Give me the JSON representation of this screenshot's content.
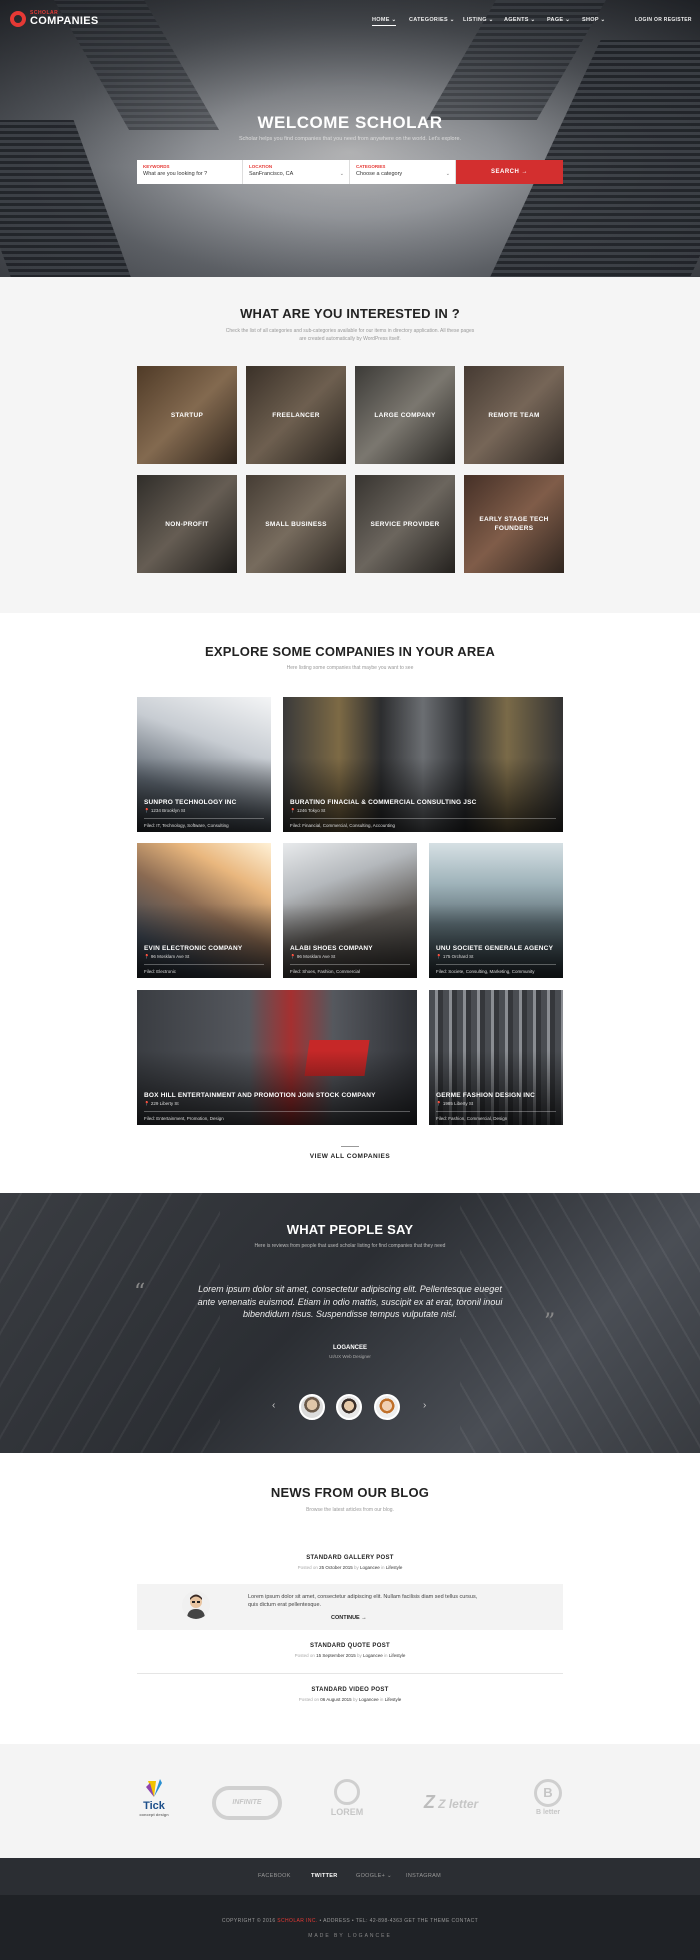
{
  "brand": {
    "small": "SCHOLAR",
    "big": "COMPANIES"
  },
  "nav": {
    "items": [
      {
        "label": "HOME ⌄"
      },
      {
        "label": "CATEGORIES ⌄"
      },
      {
        "label": "LISTING ⌄"
      },
      {
        "label": "AGENTS ⌄"
      },
      {
        "label": "PAGE ⌄"
      },
      {
        "label": "SHOP ⌄"
      }
    ],
    "login": "LOGIN OR REGISTER"
  },
  "hero": {
    "title": "WELCOME SCHOLAR",
    "subtitle": "Scholar helps you find companies that you need from anywhere on the world. Let's explore.",
    "search": {
      "keywords_label": "KEYWORDS",
      "keywords_value": "What are you looking for ?",
      "location_label": "LOCATION",
      "location_value": "SanFrancisco, CA",
      "categories_label": "CATEGORIES",
      "categories_value": "Choose a category",
      "button": "SEARCH  →"
    }
  },
  "interest": {
    "title": "WHAT ARE YOU INTERESTED IN ?",
    "subtitle_1": "Check the list of all categories and sub-categories available for our items in directory application. All these pages",
    "subtitle_2": "are created automatically by WordPress itself.",
    "tiles": [
      "STARTUP",
      "FREELANCER",
      "LARGE COMPANY",
      "REMOTE TEAM",
      "NON-PROFIT",
      "SMALL BUSINESS",
      "SERVICE PROVIDER",
      "EARLY STAGE TECH FOUNDERS"
    ]
  },
  "companies": {
    "title": "EXPLORE SOME COMPANIES IN YOUR AREA",
    "subtitle": "Here listing some companies that maybe you want to see",
    "items": [
      {
        "name": "SUNPRO TECHNOLOGY INC",
        "address": "📍 1234 Brooklyn St",
        "filed": "Filed: IT, Technology, Software, Consulting"
      },
      {
        "name": "BURATINO FINACIAL & COMMERCIAL CONSULTING JSC",
        "address": "📍 1246 Tokyo St",
        "filed": "Filed: Financial, Commercial, Consulting, Accounting"
      },
      {
        "name": "EVIN ELECTRONIC COMPANY",
        "address": "📍 96 Mosklam Ave St",
        "filed": "Filed: Electronic"
      },
      {
        "name": "ALABI SHOES COMPANY",
        "address": "📍 96 Mosklam Ave St",
        "filed": "Filed: Shoes, Fashion, Commercial"
      },
      {
        "name": "UNU SOCIETE GENERALE AGENCY",
        "address": "📍 175 Orchard St",
        "filed": "Filed: Societe, Consulting, Marketing, Community"
      },
      {
        "name": "BOX HILL ENTERTAINMENT AND PROMOTION JOIN STOCK COMPANY",
        "address": "📍 229 Liberty St",
        "filed": "Filed: Entertainment, Promotion, Design"
      },
      {
        "name": "GERME FASHION DESIGN INC",
        "address": "📍 1985 Liberty St",
        "filed": "Filed: Fashion, Commercial, Design"
      }
    ],
    "view_all": "VIEW ALL COMPANIES"
  },
  "testimonials": {
    "title": "WHAT PEOPLE SAY",
    "subtitle": "Here is reviews from people that used scholar listing for find companies that they need",
    "quote": "Lorem ipsum dolor sit amet, consectetur adipiscing elit. Pellentesque eueget ante venenatis euismod. Etiam in odio mattis, suscipit ex at erat, toronil inoui bibendidum risus. Suspendisse tempus vulputate nisl.",
    "name": "LOGANCEE",
    "role": "UI/UX Web Designer"
  },
  "blog": {
    "title": "NEWS FROM OUR BLOG",
    "subtitle": "Browse the latest articles from our blog.",
    "posts": [
      {
        "title": "STANDARD GALLERY POST",
        "posted": "Posted on",
        "date": "25 October 2015",
        "by": "by",
        "author": "Logancee",
        "in": "in",
        "cat": "Lifestyle"
      },
      {
        "title": "STANDARD QUOTE POST",
        "posted": "Posted on",
        "date": "15 September 2015",
        "by": "by",
        "author": "Logancee",
        "in": "in",
        "cat": "Lifestyle"
      },
      {
        "title": "STANDARD VIDEO POST",
        "posted": "Posted on",
        "date": "06 August 2015",
        "by": "by",
        "author": "Logancee",
        "in": "in",
        "cat": "Lifestyle"
      }
    ],
    "excerpt": "Lorem ipsum dolor sit amet, consectetur adipiscing elit. Nullam facilisis diam sed tellus cursus, quis dictum erat pellentesque.",
    "continue": "CONTINUE  →"
  },
  "logos": [
    {
      "name": "Tick",
      "sub": "concept design"
    },
    {
      "name": "INFINITE"
    },
    {
      "name": "LOREM"
    },
    {
      "name": "Z letter"
    },
    {
      "name": "B letter"
    }
  ],
  "footer": {
    "nav": [
      "FACEBOOK",
      "TWITTER",
      "GOOGLE+ ⌄",
      "INSTAGRAM"
    ],
    "copyright_1": "COPYRIGHT © 2016",
    "copyright_brand": "SCHOLAR INC.",
    "copyright_2": " • ADDRESS  •  TEL: 42-898-4363  GET THE THEME CONTACT",
    "made": "MADE BY LOGANCEE"
  },
  "colors": {
    "accent": "#e53935",
    "dark": "#2b2e33"
  }
}
